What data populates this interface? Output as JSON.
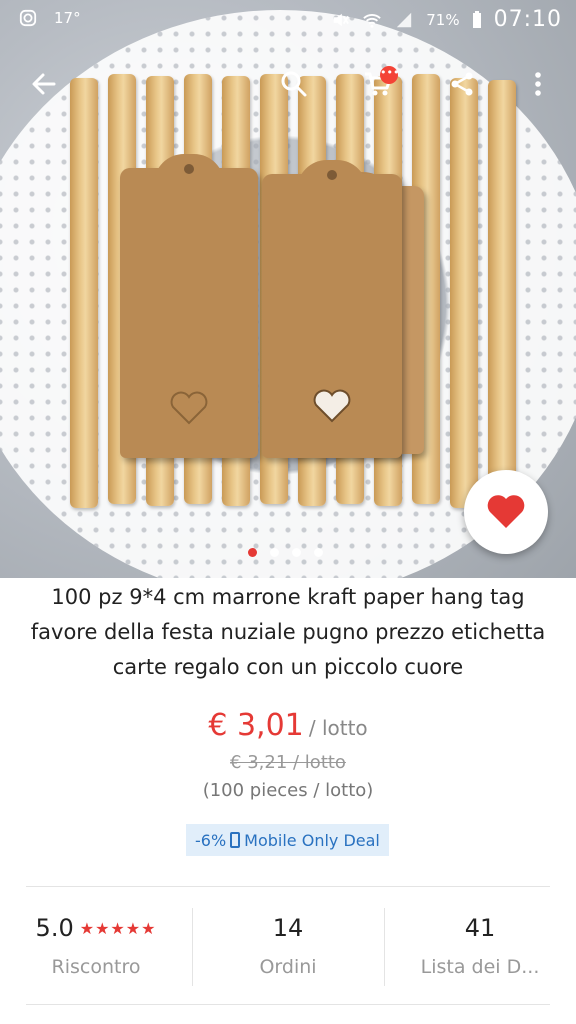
{
  "status_bar": {
    "temperature": "17°",
    "battery": "71%",
    "time": "07:10"
  },
  "toolbar": {
    "back_icon": "arrow-left-icon",
    "search_icon": "search-icon",
    "cart_icon": "cart-icon",
    "cart_badge": "•••",
    "share_icon": "share-icon",
    "more_icon": "more-vert-icon"
  },
  "carousel": {
    "image_count": 4,
    "active_index": 0
  },
  "wishlist": {
    "icon": "heart-icon",
    "color": "#e53935"
  },
  "product": {
    "title": "100 pz 9*4 cm marrone kraft paper hang tag favore della festa nuziale pugno prezzo etichetta carte regalo con un piccolo cuore",
    "price": "€ 3,01",
    "price_unit": "/ lotto",
    "original_price": "€ 3,21 / lotto",
    "pieces": "(100 pieces / lotto)",
    "deal": {
      "discount": "-6%",
      "label": "Mobile Only Deal"
    }
  },
  "stats": {
    "rating": {
      "value": "5.0",
      "stars": "★★★★★",
      "label": "Riscontro"
    },
    "orders": {
      "value": "14",
      "label": "Ordini"
    },
    "wishlist": {
      "value": "41",
      "label": "Lista dei D..."
    }
  },
  "colors": {
    "accent": "#e53935",
    "deal_bg": "#e1eefa",
    "deal_text": "#2a72c0",
    "kraft": "#b98a54"
  }
}
